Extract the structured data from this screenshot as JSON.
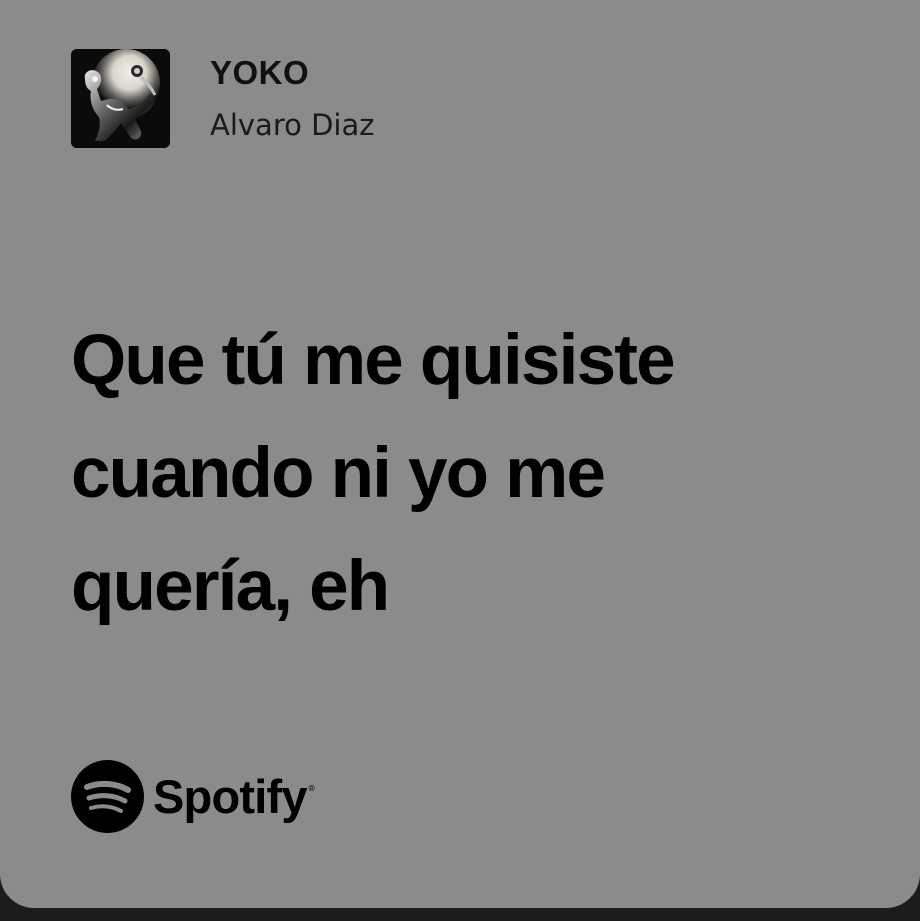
{
  "track": {
    "title": "YOKO",
    "artist": "Alvaro Diaz",
    "cover_icon": "album-cover-art"
  },
  "lyrics": {
    "lines": [
      "Que tú me quisiste",
      "cuando ni yo me",
      "quería, eh"
    ]
  },
  "brand": {
    "name": "Spotify",
    "registered_mark": "®",
    "icon": "spotify-logo-icon"
  },
  "colors": {
    "card_background": "#8b8b8b",
    "page_background": "#1c1c1c",
    "text": "#000000"
  }
}
